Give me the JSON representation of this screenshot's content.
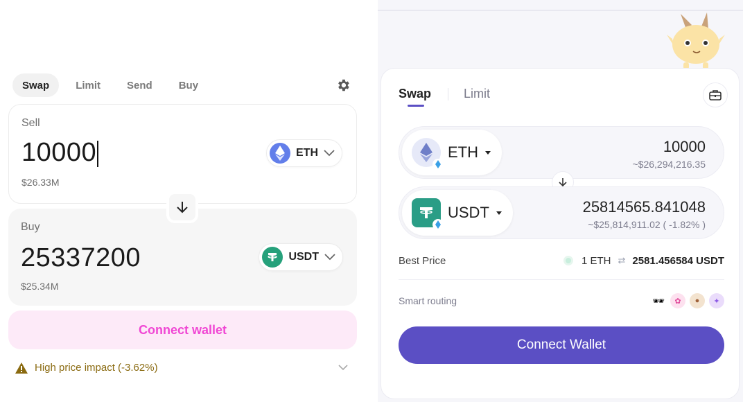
{
  "left": {
    "tabs": [
      {
        "label": "Swap",
        "active": true
      },
      {
        "label": "Limit",
        "active": false
      },
      {
        "label": "Send",
        "active": false
      },
      {
        "label": "Buy",
        "active": false
      }
    ],
    "settings_icon": "gear-icon",
    "sell": {
      "label": "Sell",
      "amount": "10000",
      "usd": "$26.33M",
      "token": "ETH",
      "token_color": "#627eea"
    },
    "buy": {
      "label": "Buy",
      "amount": "25337200",
      "usd": "$25.34M",
      "token": "USDT",
      "token_color": "#26a17b"
    },
    "switch_icon": "arrow-down-icon",
    "connect_label": "Connect wallet",
    "impact_text": "High price impact (-3.62%)",
    "accent_color": "#f047d4"
  },
  "right": {
    "tabs": [
      {
        "label": "Swap",
        "active": true
      },
      {
        "label": "Limit",
        "active": false
      }
    ],
    "wallet_icon": "briefcase-icon",
    "from": {
      "token": "ETH",
      "amount": "10000",
      "usd": "~$26,294,216.35"
    },
    "to": {
      "token": "USDT",
      "amount": "25814565.841048",
      "usd": "~$25,814,911.02 ( -1.82% )"
    },
    "best_price": {
      "label": "Best Price",
      "lhs": "1 ETH",
      "rhs": "2581.456584 USDT"
    },
    "smart_routing": {
      "label": "Smart routing",
      "dex_icons": [
        "sunglasses-icon",
        "unicorn-icon",
        "bunny-icon",
        "sparkle-icon"
      ]
    },
    "connect_label": "Connect Wallet",
    "accent_color": "#5b4fc4"
  }
}
